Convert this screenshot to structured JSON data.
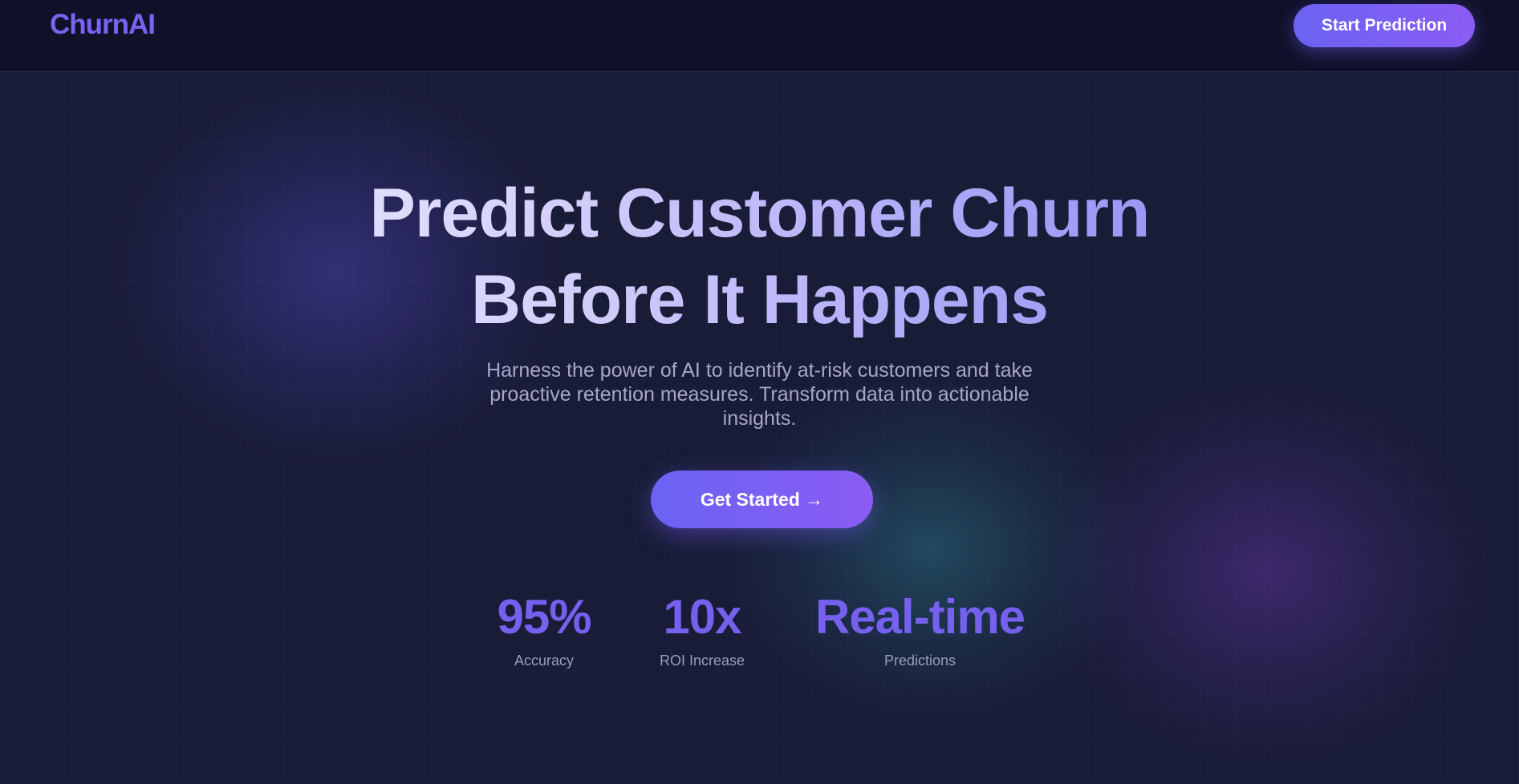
{
  "nav": {
    "logo": "ChurnAI",
    "cta_label": "Start Prediction"
  },
  "hero": {
    "title_line1": "Predict Customer Churn",
    "title_line2": "Before It Happens",
    "subtitle": "Harness the power of AI to identify at-risk customers and take proactive retention measures. Transform data into actionable insights.",
    "cta_label": "Get Started →"
  },
  "stats": [
    {
      "value": "95%",
      "label": "Accuracy"
    },
    {
      "value": "10x",
      "label": "ROI Increase"
    },
    {
      "value": "Real-time",
      "label": "Predictions"
    }
  ],
  "colors": {
    "background": "#191c37",
    "navbar": "#0f1129",
    "accent": "#7a63f0",
    "button_gradient_start": "#6a63f3",
    "button_gradient_end": "#8b5cf4",
    "muted_text": "#a6a7c8"
  }
}
